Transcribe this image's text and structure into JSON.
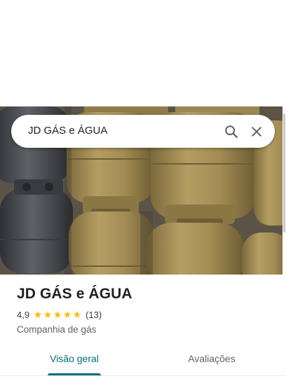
{
  "search": {
    "query": "JD GÁS e ÁGUA"
  },
  "place": {
    "name": "JD GÁS e ÁGUA",
    "rating": "4,9",
    "stars": [
      "★",
      "★",
      "★",
      "★",
      "★"
    ],
    "review_count": "(13)",
    "category": "Companhia de gás"
  },
  "tabs": [
    {
      "label": "Visão geral",
      "selected": true
    },
    {
      "label": "Avaliações",
      "selected": false
    }
  ],
  "colors": {
    "accent": "#00707a",
    "star": "#fbbc04",
    "canister_gold": "#a48e55",
    "canister_gray": "#4d4f54"
  },
  "icons": {
    "search": "search-icon",
    "close": "close-icon"
  }
}
